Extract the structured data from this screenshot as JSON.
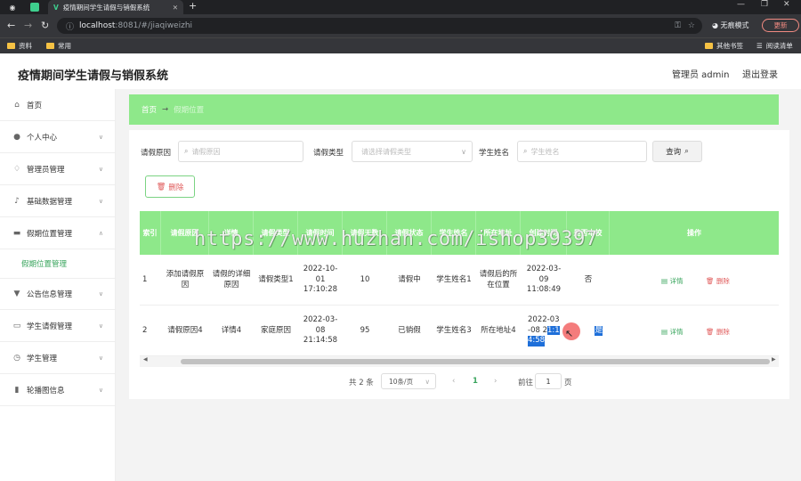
{
  "browser": {
    "tab_title": "疫情期间学生请假与销假系统",
    "new_tab": "+",
    "url_host": "localhost",
    "url_rest": ":8081/#/jiaqiweizhi",
    "incognito": "无痕模式",
    "update": "更新",
    "bookmarks": [
      "资料",
      "常用"
    ],
    "bookmarks_right": [
      "其他书签",
      "阅读清单"
    ]
  },
  "header": {
    "title": "疫情期间学生请假与销假系统",
    "admin": "管理员 admin",
    "logout": "退出登录"
  },
  "sidebar": {
    "items": [
      {
        "label": "首页",
        "icon": "home-icon"
      },
      {
        "label": "个人中心",
        "icon": "user-icon"
      },
      {
        "label": "管理员管理",
        "icon": "bell-icon"
      },
      {
        "label": "基础数据管理",
        "icon": "mic-icon"
      },
      {
        "label": "假期位置管理",
        "icon": "message-icon"
      },
      {
        "label": "公告信息管理",
        "icon": "megaphone-icon"
      },
      {
        "label": "学生请假管理",
        "icon": "chat-icon"
      },
      {
        "label": "学生管理",
        "icon": "clock-icon"
      },
      {
        "label": "轮播图信息",
        "icon": "chart-icon"
      }
    ],
    "sub_item": "假期位置管理"
  },
  "breadcrumb": {
    "home": "首页",
    "current": "假期位置"
  },
  "filters": {
    "reason_label": "请假原因",
    "reason_placeholder": "请假原因",
    "type_label": "请假类型",
    "type_placeholder": "请选择请假类型",
    "name_label": "学生姓名",
    "name_placeholder": "学生姓名",
    "query": "查询",
    "delete": "删除"
  },
  "table": {
    "headers": [
      "索引",
      "请假原因",
      "详情",
      "请假类型",
      "请假时间",
      "请假天数",
      "请假状态",
      "学生姓名",
      "所在地址",
      "创建时间",
      "是否本校",
      "操作"
    ],
    "rows": [
      {
        "index": "1",
        "reason": "添加请假原因",
        "detail": "请假的详细原因",
        "type": "请假类型1",
        "time": "2022-10-01 17:10:28",
        "days": "10",
        "status": "请假中",
        "name": "学生姓名1",
        "address": "请假后的所在位置",
        "created": "2022-03-09 11:08:49",
        "local": "否"
      },
      {
        "index": "2",
        "reason": "请假原因4",
        "detail": "详情4",
        "type": "家庭原因",
        "time": "2022-03-08 21:14:58",
        "days": "95",
        "status": "已销假",
        "name": "学生姓名3",
        "address": "所在地址4",
        "created_a": "2022-03",
        "created_b": "-08 2",
        "created_hl": "1:1",
        "created_c": "4:58",
        "local": "是"
      }
    ],
    "op_detail": "详情",
    "op_delete": "删除"
  },
  "pagination": {
    "total": "共 2 条",
    "page_size": "10条/页",
    "current": "1",
    "goto": "前往",
    "goto_value": "1",
    "page_unit": "页"
  },
  "watermark": "https://www.huzhan.com/ishop39397"
}
